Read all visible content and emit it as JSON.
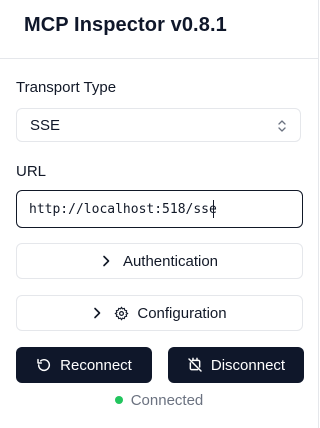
{
  "app": {
    "title": "MCP Inspector v0.8.1"
  },
  "transport": {
    "label": "Transport Type",
    "selected": "SSE"
  },
  "url": {
    "label": "URL",
    "value": "http://localhost:518/sse"
  },
  "authentication": {
    "label": "Authentication"
  },
  "configuration": {
    "label": "Configuration"
  },
  "actions": {
    "reconnect": "Reconnect",
    "disconnect": "Disconnect"
  },
  "status": {
    "text": "Connected",
    "color": "#22c55e"
  },
  "icons": {
    "caret": "chevron-up-down-icon",
    "chevron": "chevron-right-icon",
    "gear": "gear-icon",
    "reconnect": "rotate-ccw-icon",
    "disconnect": "unplug-icon"
  }
}
